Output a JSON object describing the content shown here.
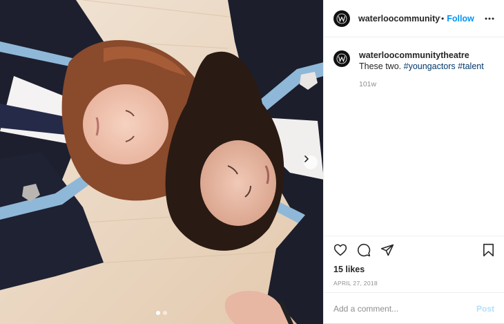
{
  "post": {
    "account": {
      "username_truncated": "waterloocommunitythea",
      "username": "waterloocommunitytheatre",
      "avatar_icon": "theatre-logo-icon"
    },
    "header": {
      "separator": "•",
      "follow_label": "Follow",
      "more_icon": "more-options-icon"
    },
    "caption": {
      "text": "These two.",
      "hashtags": [
        "#youngactors",
        "#talent"
      ],
      "time_ago": "101w"
    },
    "actions": {
      "icons": [
        "heart-icon",
        "comment-icon",
        "share-icon",
        "bookmark-icon"
      ]
    },
    "likes": "15 likes",
    "date": "APRIL 27, 2018",
    "comment_box": {
      "placeholder": "Add a comment...",
      "post_label": "Post"
    },
    "carousel": {
      "slide_count": 2,
      "active_index": 0,
      "next_icon": "chevron-right-icon"
    },
    "colors": {
      "follow_blue": "#0095f6",
      "hashtag_blue": "#00376b",
      "post_disabled": "#b2dffc",
      "muted_gray": "#8e8e8e"
    }
  }
}
